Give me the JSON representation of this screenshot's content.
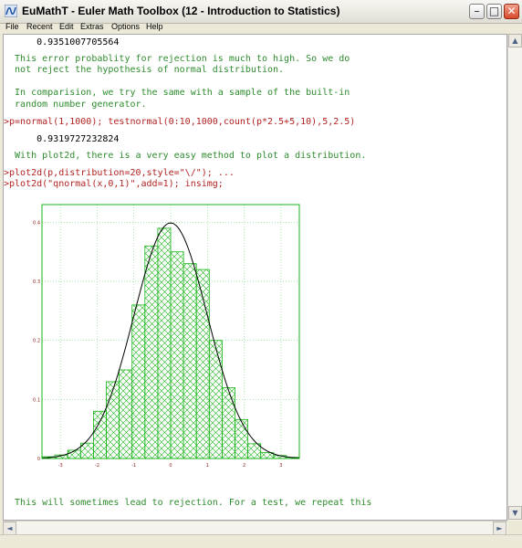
{
  "window": {
    "title": "EuMathT - Euler Math Toolbox (12 - Introduction to Statistics)",
    "minimize_glyph": "–",
    "maximize_glyph": "□",
    "close_glyph": "✕"
  },
  "menu": {
    "items": [
      "File",
      "Recent",
      "Edit",
      "Extras",
      "Options",
      "Help"
    ]
  },
  "notebook": {
    "lines": [
      {
        "kind": "out",
        "text": "      0.9351007705564"
      },
      {
        "kind": "cmt",
        "text": "  This error probablity for rejection is much to high. So we do"
      },
      {
        "kind": "cmt",
        "text": "  not reject the hypothesis of normal distribution."
      },
      {
        "kind": "cmt",
        "text": "  In comparision, we try the same with a sample of the built-in"
      },
      {
        "kind": "cmt",
        "text": "  random number generator."
      },
      {
        "kind": "cmd",
        "text": ">p=normal(1,1000); testnormal(0:10,1000,count(p*2.5+5,10),5,2.5)"
      },
      {
        "kind": "out",
        "text": "      0.9319727232824"
      },
      {
        "kind": "cmt",
        "text": "  With plot2d, there is a very easy method to plot a distribution."
      },
      {
        "kind": "cmd",
        "text": ">plot2d(p,distribution=20,style=\"\\/\"); ..."
      },
      {
        "kind": "cmd",
        "text": ">plot2d(\"qnormal(x,0,1)\",add=1); insimg;"
      },
      {
        "kind": "cmt",
        "text": "  This will sometimes lead to rejection. For a test, we repeat this"
      }
    ]
  },
  "chart_data": {
    "type": "bar",
    "title": "",
    "xlabel": "",
    "ylabel": "",
    "xlim": [
      -3.5,
      3.5
    ],
    "ylim": [
      0,
      0.43
    ],
    "x_ticks": [
      "-3",
      "-2",
      "-1",
      "0",
      "1",
      "2",
      "3"
    ],
    "y_ticks": [
      "0",
      "0.1",
      "0.2",
      "0.3",
      "0.4"
    ],
    "bin_edges": [
      -3.5,
      -3.15,
      -2.8,
      -2.45,
      -2.1,
      -1.75,
      -1.4,
      -1.05,
      -0.7,
      -0.35,
      0.0,
      0.35,
      0.7,
      1.05,
      1.4,
      1.75,
      2.1,
      2.45,
      2.8,
      3.15,
      3.5
    ],
    "values": [
      0.003,
      0.006,
      0.014,
      0.026,
      0.08,
      0.13,
      0.15,
      0.26,
      0.36,
      0.39,
      0.35,
      0.33,
      0.32,
      0.2,
      0.12,
      0.066,
      0.025,
      0.01,
      0.005,
      0.002
    ],
    "series": [
      {
        "style": "histogram",
        "color": "#17b317",
        "hatch": "\\/"
      },
      {
        "style": "curve",
        "function": "qnormal(x,0,1)",
        "color": "#000000"
      }
    ],
    "grid": true,
    "frame_color": "#17b317",
    "tick_label_color": "#8b1a1a"
  },
  "colors": {
    "comment": "#2e8b2e",
    "command": "#b22222",
    "output": "#000000"
  },
  "scroll": {
    "up_glyph": "▲",
    "down_glyph": "▼",
    "left_glyph": "◄",
    "right_glyph": "►"
  }
}
